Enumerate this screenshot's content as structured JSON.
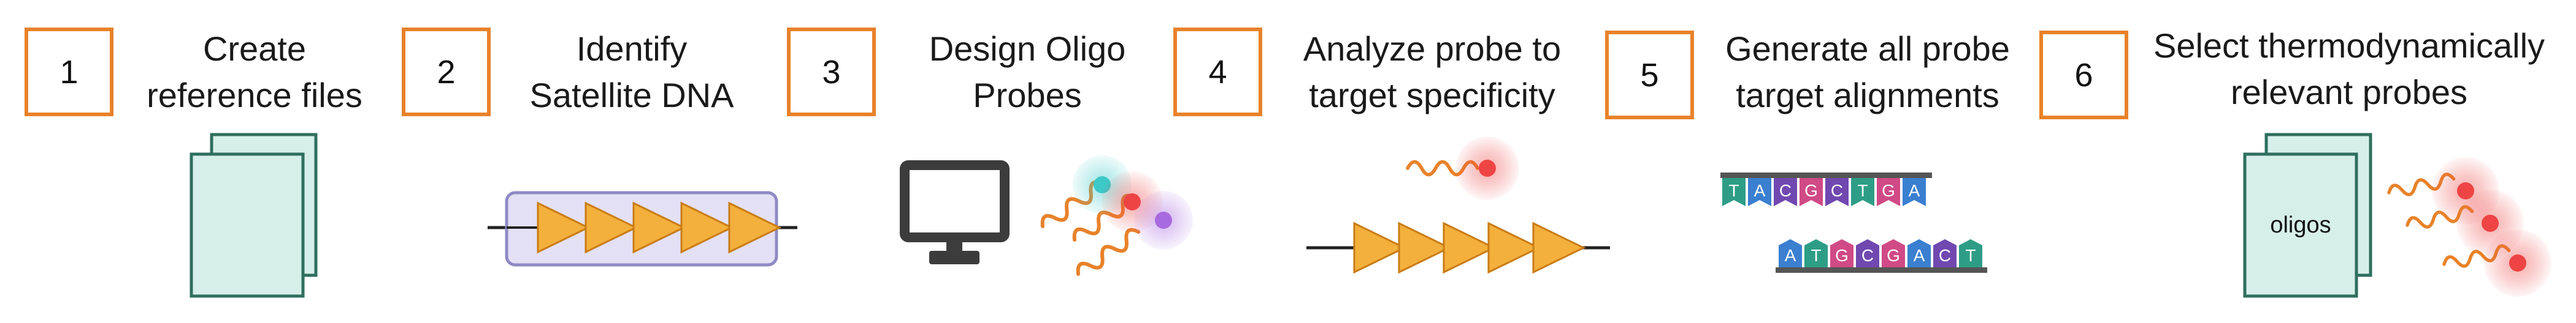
{
  "steps": [
    {
      "number": "1",
      "line1": "Create",
      "line2": "reference files"
    },
    {
      "number": "2",
      "line1": "Identify",
      "line2": "Satellite DNA"
    },
    {
      "number": "3",
      "line1": "Design Oligo",
      "line2": "Probes"
    },
    {
      "number": "4",
      "line1": "Analyze probe to",
      "line2": "target specificity"
    },
    {
      "number": "5",
      "line1": "Generate all probe",
      "line2": "target alignments"
    },
    {
      "number": "6",
      "line1": "Select thermodynamically",
      "line2": "relevant probes"
    }
  ],
  "step6": {
    "doc_label": "oligos"
  },
  "step5": {
    "top_strand": [
      "T",
      "A",
      "C",
      "G",
      "C",
      "T",
      "G",
      "A"
    ],
    "bottom_strand": [
      "A",
      "T",
      "G",
      "C",
      "G",
      "A",
      "C",
      "T"
    ]
  },
  "colors": {
    "accent_orange": "#e8822a",
    "doc_fill": "#d7efe9",
    "doc_stroke": "#2f6f5e",
    "repeat_fill": "#f3b03c",
    "repeat_box": "#e4e0f5",
    "probe_red": "#ee4444",
    "probe_teal": "#3ec8c8",
    "probe_purple": "#a86ae0",
    "base_T": "#2e9d86",
    "base_A": "#3b7fd0",
    "base_C": "#7048b0",
    "base_G": "#d04a86"
  }
}
